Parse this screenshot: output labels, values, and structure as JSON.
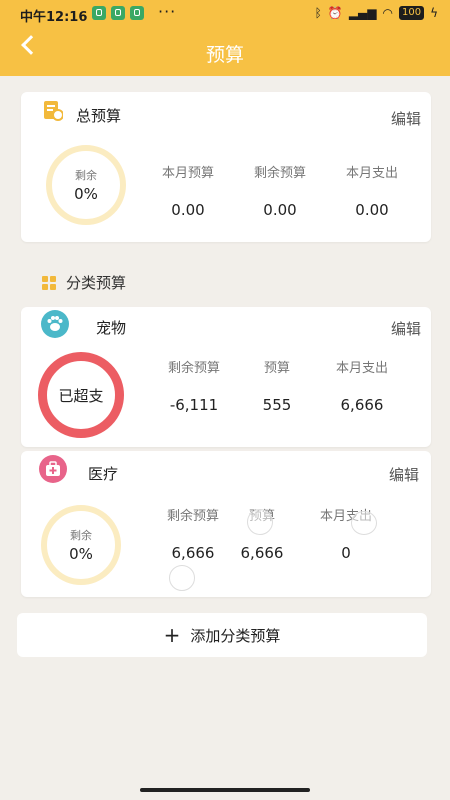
{
  "status_bar": {
    "time": "中午12:16",
    "more": "···",
    "battery": "100"
  },
  "nav": {
    "title": "预算"
  },
  "total_budget": {
    "title": "总预算",
    "edit_label": "编辑",
    "ring": {
      "label": "剩余",
      "value": "0%",
      "fraction": 0
    },
    "stats": [
      {
        "label": "本月预算",
        "value": "0.00"
      },
      {
        "label": "剩余预算",
        "value": "0.00"
      },
      {
        "label": "本月支出",
        "value": "0.00"
      }
    ]
  },
  "category_section": {
    "title": "分类预算"
  },
  "categories": [
    {
      "name": "宠物",
      "icon": "paw-icon",
      "icon_color": "#4bb8c9",
      "edit_label": "编辑",
      "ring": {
        "text": "已超支",
        "color": "#ec5d63"
      },
      "stats": [
        {
          "label": "剩余预算",
          "value": "-6,111"
        },
        {
          "label": "预算",
          "value": "555"
        },
        {
          "label": "本月支出",
          "value": "6,666"
        }
      ]
    },
    {
      "name": "医疗",
      "icon": "medical-kit-icon",
      "icon_color": "#e8648a",
      "edit_label": "编辑",
      "ring": {
        "label": "剩余",
        "value": "0%",
        "fraction": 0
      },
      "stats": [
        {
          "label": "剩余预算",
          "value": "6,666"
        },
        {
          "label": "预算",
          "value": "6,666"
        },
        {
          "label": "本月支出",
          "value": "0"
        }
      ]
    }
  ],
  "add_button": {
    "label": "添加分类预算"
  },
  "colors": {
    "header": "#f7c144",
    "ring_track": "#fbecc1",
    "over_budget": "#ec5d63"
  }
}
